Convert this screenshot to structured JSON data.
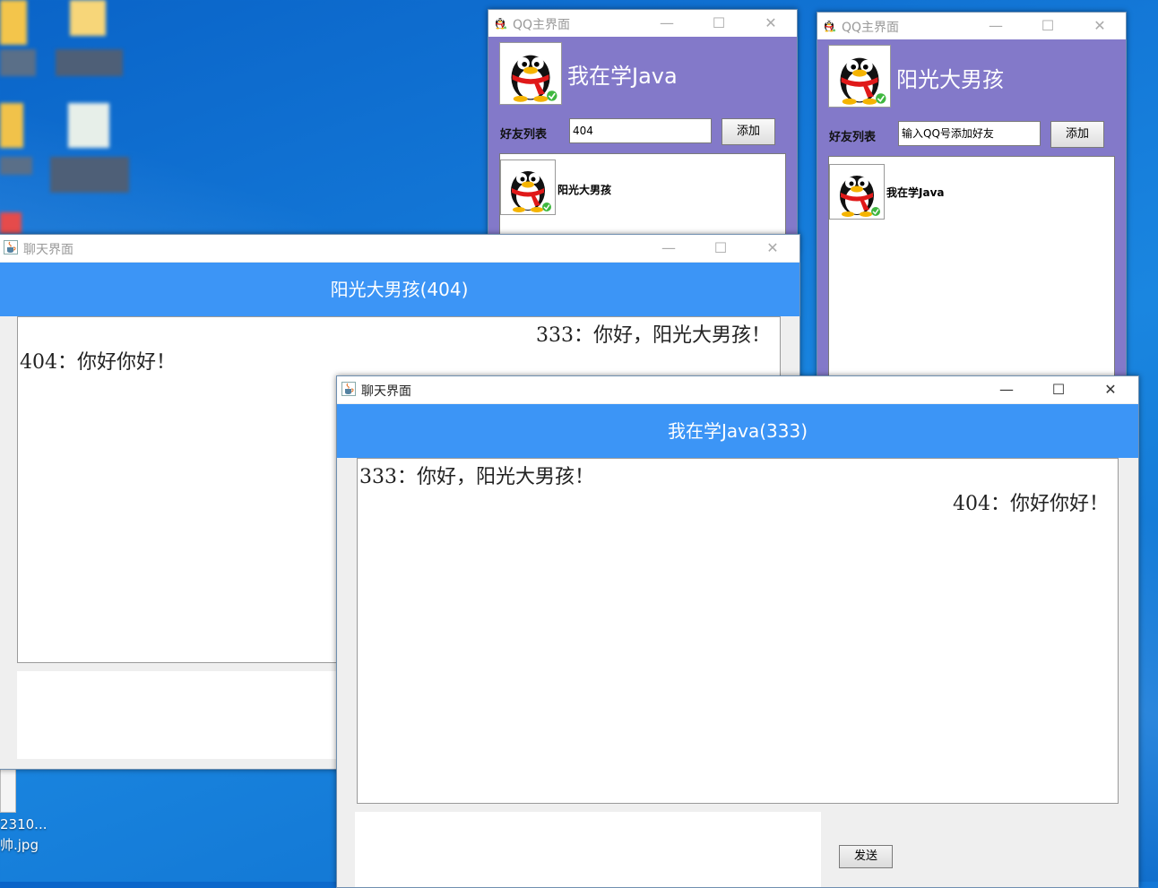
{
  "desktop": {
    "file_label_line1": "2310...",
    "file_label_line2": "帅.jpg"
  },
  "qq_window_1": {
    "title": "QQ主界面",
    "nickname": "我在学Java",
    "friend_list_label": "好友列表",
    "input_value": "404",
    "add_button": "添加",
    "friends": [
      {
        "name": "阳光大男孩"
      }
    ]
  },
  "qq_window_2": {
    "title": "QQ主界面",
    "nickname": "阳光大男孩",
    "friend_list_label": "好友列表",
    "input_value": "输入QQ号添加好友",
    "add_button": "添加",
    "friends": [
      {
        "name": "我在学Java"
      }
    ]
  },
  "chat_window_1": {
    "title": "聊天界面",
    "header": "阳光大男孩(404)",
    "messages": [
      {
        "text": "333：你好，阳光大男孩！",
        "align": "right"
      },
      {
        "text": "404：你好你好！",
        "align": "left"
      }
    ]
  },
  "chat_window_2": {
    "title": "聊天界面",
    "header": "我在学Java(333)",
    "messages": [
      {
        "text": "333：你好，阳光大男孩！",
        "align": "left"
      },
      {
        "text": "404：你好你好！",
        "align": "right"
      }
    ],
    "send_button": "发送"
  },
  "window_controls": {
    "minimize": "—",
    "maximize": "☐",
    "close": "✕"
  },
  "icons": {
    "qq_app": "penguin-icon",
    "java_app": "java-coffee-icon",
    "avatar": "penguin-avatar-icon"
  },
  "colors": {
    "desktop_blue": "#1479d8",
    "qq_body_purple": "#8379c9",
    "chat_header_blue": "#3c95f6"
  }
}
